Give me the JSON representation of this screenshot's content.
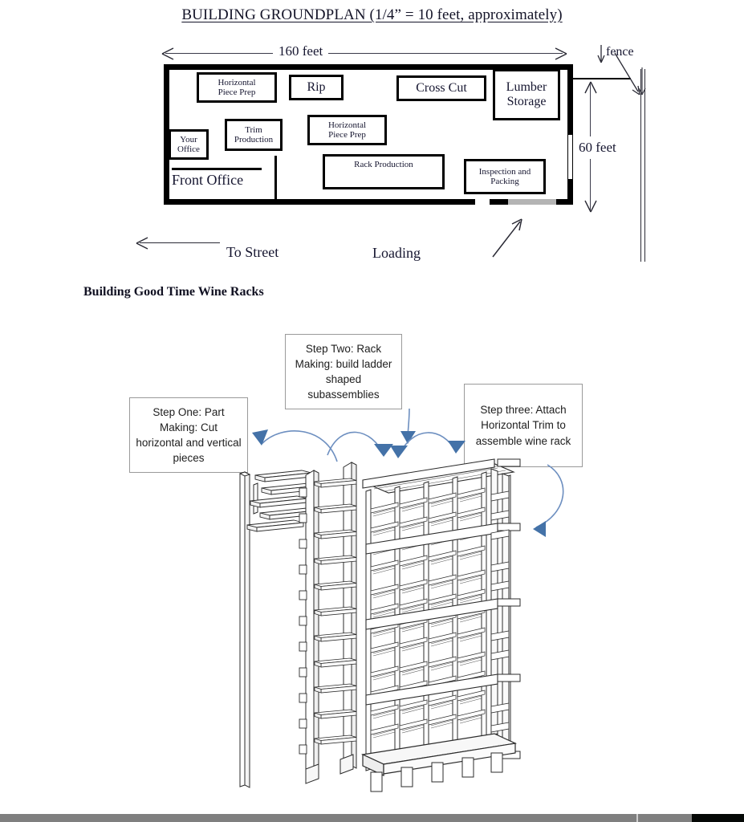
{
  "plan": {
    "title_prefix": "BUILDING GROUNDPLAN (1/4",
    "title_full": "BUILDING GROUNDPLAN (1/4” = 10 feet, approximately)",
    "dimensions": {
      "width_label": "160 feet",
      "height_label": "60 feet"
    },
    "departments": [
      {
        "id": "horiz-prep-1",
        "label": "Horizontal\nPiece Prep"
      },
      {
        "id": "rip",
        "label": "Rip"
      },
      {
        "id": "cross-cut",
        "label": "Cross Cut"
      },
      {
        "id": "lumber-storage",
        "label": "Lumber\nStorage"
      },
      {
        "id": "your-office",
        "label": "Your\nOffice"
      },
      {
        "id": "trim-production",
        "label": "Trim\nProduction"
      },
      {
        "id": "horiz-prep-2",
        "label": "Horizontal\nPiece Prep"
      },
      {
        "id": "rack-production",
        "label": "Rack Production"
      },
      {
        "id": "inspection-packing",
        "label": "Inspection and\nPacking"
      }
    ],
    "front_office_label": "Front Office",
    "fence_label": "fence",
    "to_street_label": "To Street",
    "loading_label": "Loading"
  },
  "process": {
    "heading": "Building Good Time Wine Racks",
    "steps": [
      {
        "id": "step-one",
        "label": "Step One:  Part Making:  Cut horizontal and vertical pieces"
      },
      {
        "id": "step-two",
        "label": "Step Two:  Rack Making:  build ladder shaped subassemblies"
      },
      {
        "id": "step-three",
        "label": "Step three:  Attach Horizontal Trim to assemble wine rack"
      }
    ]
  },
  "colors": {
    "arrow_blue": "#4472a8",
    "wall_black": "#000000",
    "text_ink": "#161630",
    "strip_gray": "#7f7f7f"
  }
}
